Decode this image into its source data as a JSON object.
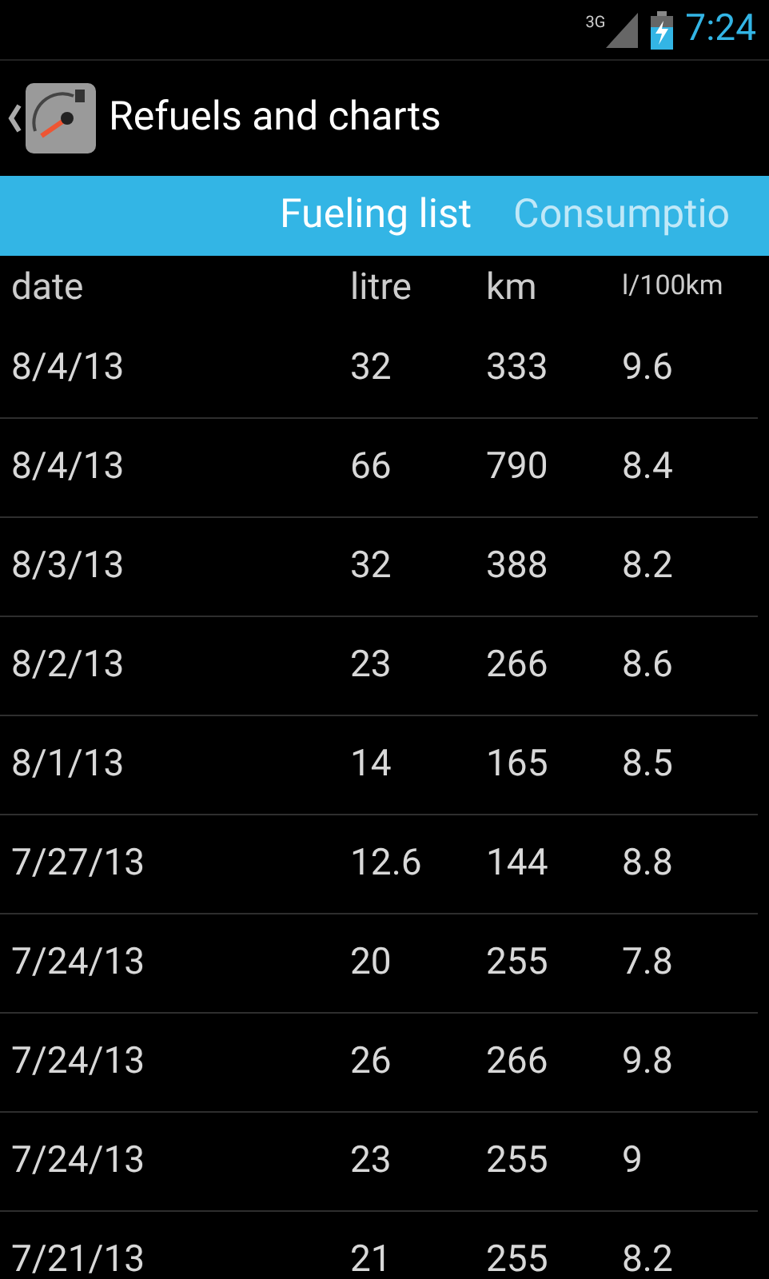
{
  "status_bar": {
    "network": "3G",
    "time": "7:24"
  },
  "action_bar": {
    "title": "Refuels and charts"
  },
  "tabs": [
    {
      "label": "Fueling list",
      "selected": true
    },
    {
      "label": "Consumptio",
      "selected": false
    }
  ],
  "table": {
    "columns": [
      "date",
      "litre",
      "km",
      "l/100km"
    ],
    "rows": [
      [
        "8/4/13",
        "32",
        "333",
        "9.6"
      ],
      [
        "8/4/13",
        "66",
        "790",
        "8.4"
      ],
      [
        "8/3/13",
        "32",
        "388",
        "8.2"
      ],
      [
        "8/2/13",
        "23",
        "266",
        "8.6"
      ],
      [
        "8/1/13",
        "14",
        "165",
        "8.5"
      ],
      [
        "7/27/13",
        "12.6",
        "144",
        "8.8"
      ],
      [
        "7/24/13",
        "20",
        "255",
        "7.8"
      ],
      [
        "7/24/13",
        "26",
        "266",
        "9.8"
      ],
      [
        "7/24/13",
        "23",
        "255",
        "9"
      ],
      [
        "7/21/13",
        "21",
        "255",
        "8.2"
      ]
    ]
  }
}
